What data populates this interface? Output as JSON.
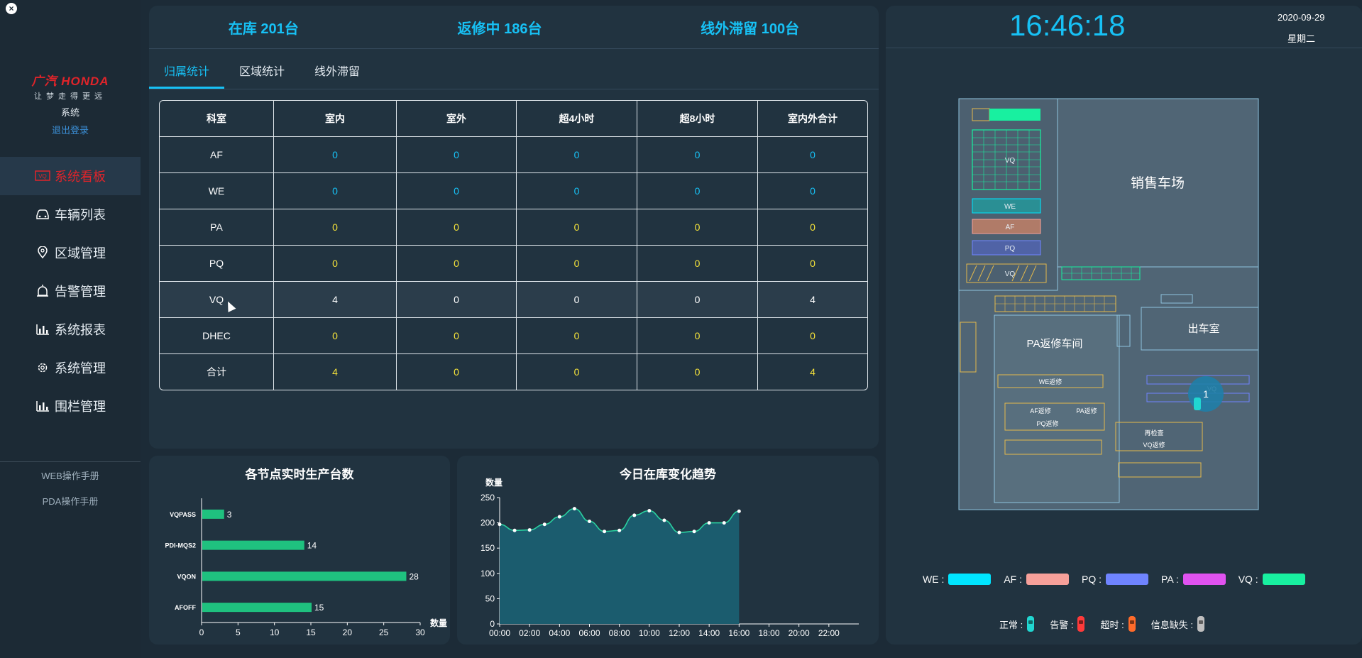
{
  "sidebar": {
    "close_icon": "×",
    "logo_brand": "广汽 HONDA",
    "logo_slogan": "让梦走得更远",
    "system_label": "系统",
    "logout": "退出登录",
    "menu": [
      {
        "label": "系统看板",
        "icon": "dashboard-icon",
        "active": true
      },
      {
        "label": "车辆列表",
        "icon": "car-icon"
      },
      {
        "label": "区域管理",
        "icon": "map-pin-icon"
      },
      {
        "label": "告警管理",
        "icon": "alarm-icon"
      },
      {
        "label": "系统报表",
        "icon": "bar-chart-icon"
      },
      {
        "label": "系统管理",
        "icon": "gear-icon"
      },
      {
        "label": "围栏管理",
        "icon": "bar-chart-icon"
      }
    ],
    "manuals": [
      "WEB操作手册",
      "PDA操作手册"
    ]
  },
  "stats": {
    "in_stock": "在库 201台",
    "repairing": "返修中 186台",
    "offline": "线外滞留 100台"
  },
  "tabs": [
    "归属统计",
    "区域统计",
    "线外滞留"
  ],
  "table": {
    "headers": [
      "科室",
      "室内",
      "室外",
      "超4小时",
      "超8小时",
      "室内外合计"
    ],
    "rows": [
      {
        "name": "AF",
        "values": [
          "0",
          "0",
          "0",
          "0",
          "0"
        ],
        "color": "blue"
      },
      {
        "name": "WE",
        "values": [
          "0",
          "0",
          "0",
          "0",
          "0"
        ],
        "color": "blue"
      },
      {
        "name": "PA",
        "values": [
          "0",
          "0",
          "0",
          "0",
          "0"
        ],
        "color": "yellow"
      },
      {
        "name": "PQ",
        "values": [
          "0",
          "0",
          "0",
          "0",
          "0"
        ],
        "color": "yellow"
      },
      {
        "name": "VQ",
        "values": [
          "4",
          "0",
          "0",
          "0",
          "4"
        ],
        "color": "white",
        "highlight": true
      },
      {
        "name": "DHEC",
        "values": [
          "0",
          "0",
          "0",
          "0",
          "0"
        ],
        "color": "yellow"
      },
      {
        "name": "合计",
        "values": [
          "4",
          "0",
          "0",
          "0",
          "4"
        ],
        "color": "yellow"
      }
    ]
  },
  "colors": {
    "accent": "#17c1f5",
    "bar": "#1fc17f",
    "area_fill": "#1b5c6e",
    "area_line": "#2ad1a0",
    "active_menu": "#e0242a"
  },
  "chart_data": [
    {
      "type": "bar",
      "orientation": "horizontal",
      "title": "各节点实时生产台数",
      "xlabel": "数量",
      "categories": [
        "VQPASS",
        "PDI-MQS2",
        "VQON",
        "AFOFF"
      ],
      "values": [
        3,
        14,
        28,
        15
      ],
      "xlim": [
        0,
        30
      ],
      "xticks": [
        "0",
        "5",
        "10",
        "15",
        "20",
        "25",
        "30"
      ]
    },
    {
      "type": "area",
      "title": "今日在库变化趋势",
      "ylabel": "数量",
      "ylim": [
        0,
        250
      ],
      "yticks": [
        "0",
        "50",
        "100",
        "150",
        "200",
        "250"
      ],
      "xticks": [
        "00:00",
        "02:00",
        "04:00",
        "06:00",
        "08:00",
        "10:00",
        "12:00",
        "14:00",
        "16:00",
        "18:00",
        "20:00",
        "22:00"
      ],
      "x": [
        0,
        1,
        2,
        3,
        4,
        5,
        6,
        7,
        8,
        9,
        10,
        11,
        12,
        13,
        14,
        15,
        16
      ],
      "y": [
        197,
        185,
        186,
        197,
        212,
        228,
        203,
        183,
        185,
        215,
        224,
        205,
        181,
        183,
        200,
        200,
        223
      ]
    }
  ],
  "clock": {
    "time": "16:46:18",
    "date": "2020-09-29",
    "weekday": "星期二"
  },
  "map": {
    "sales_lot": "销售车场",
    "pa_workshop": "PA返修车间",
    "exit_room": "出车室",
    "zone_vq": "VQ",
    "zone_we": "WE",
    "zone_af": "AF",
    "zone_pq": "PQ",
    "we_repair": "WE返修",
    "af_repair": "AF返修",
    "pa_repair": "PA返修",
    "pq_repair": "PQ返修",
    "recheck": "再检查",
    "vq_repair": "VQ返修",
    "cluster_count": "1"
  },
  "legend_zones": [
    {
      "label": "WE :",
      "color": "#00e5ff"
    },
    {
      "label": "AF :",
      "color": "#f6a09a"
    },
    {
      "label": "PQ :",
      "color": "#6f84ff"
    },
    {
      "label": "PA :",
      "color": "#e052f0"
    },
    {
      "label": "VQ :",
      "color": "#18f0a0"
    }
  ],
  "legend_status": [
    {
      "label": "正常 :",
      "color": "#21d6d1"
    },
    {
      "label": "告警 :",
      "color": "#ff3a3a"
    },
    {
      "label": "超时 :",
      "color": "#ff6b2a"
    },
    {
      "label": "信息缺失 :",
      "color": "#bfbfbf"
    }
  ]
}
